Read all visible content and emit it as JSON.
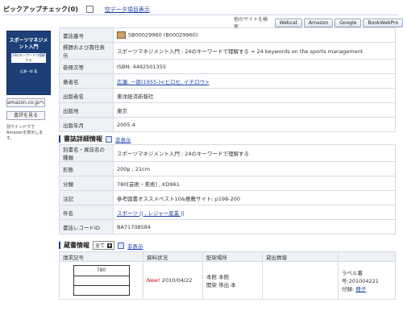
{
  "header": {
    "pickup_label": "ピックアップチェック(0)",
    "show_empty_label": "空データ項目表示",
    "other_sites_label": "他のサイトを検索",
    "sites": [
      "Webcat",
      "Amazon",
      "Google",
      "BookWebPro"
    ]
  },
  "cover": {
    "title_line1": "スポーツマネジメント入門",
    "title_line2": "24のキーワードで理解する",
    "author": "広瀬一郎 著",
    "amazon_button": "amazon.co.jpへ",
    "review_button": "書評を見る",
    "note": "別ウインドウでAmazonを表示します。"
  },
  "bib": [
    {
      "key": "書誌番号",
      "value": "SB00029960 (B00029960)",
      "icon": "book-icon"
    },
    {
      "key": "標題および責任表示",
      "value": "スポーツマネジメント入門 : 24のキーワードで理解する = 24 keywords on the sports management"
    },
    {
      "key": "巻冊次等",
      "value": "ISBN: 4492501355"
    },
    {
      "key": "著者名",
      "value": "広瀬, 一郎(1955-)<ヒロセ, イチロウ>",
      "link": true
    },
    {
      "key": "出版者名",
      "value": "東洋経済新報社"
    },
    {
      "key": "出版地",
      "value": "東京"
    },
    {
      "key": "出版年月",
      "value": "2005.4"
    }
  ],
  "details_section": {
    "title": "書誌詳細情報",
    "toggle_label": "非表示"
  },
  "details": [
    {
      "key": "別書名・異誌名の種類",
      "value": "スポーツマネジメント入門 : 24のキーワードで理解する"
    },
    {
      "key": "形態",
      "value": "200p ; 21cm"
    },
    {
      "key": "分類",
      "value": "780[芸術・美術] , KD961"
    },
    {
      "key": "注記",
      "value": "参考図書オススメベスト10&推薦サイト: p198-200"
    },
    {
      "key": "件名",
      "value": "スポーツ || , レジャー産業 ||",
      "link": true
    },
    {
      "key": "書誌レコードID",
      "value": "BA71708584"
    }
  ],
  "holdings_section": {
    "title": "蔵書情報",
    "select_value": "全て",
    "toggle_label": "非表示"
  },
  "holdings": {
    "headers": [
      "請求記号",
      "資料状況",
      "配架場所",
      "貸出情報",
      ""
    ],
    "row": {
      "call_number": "780",
      "new_tag": "New!",
      "date": "2010/04/22",
      "location_line1": "本館 本館",
      "location_line2": "開架 帯出 本",
      "label_number": "ラベル番号:201004221",
      "appendix_label": "付録:",
      "appendix_link": "冊子"
    }
  }
}
